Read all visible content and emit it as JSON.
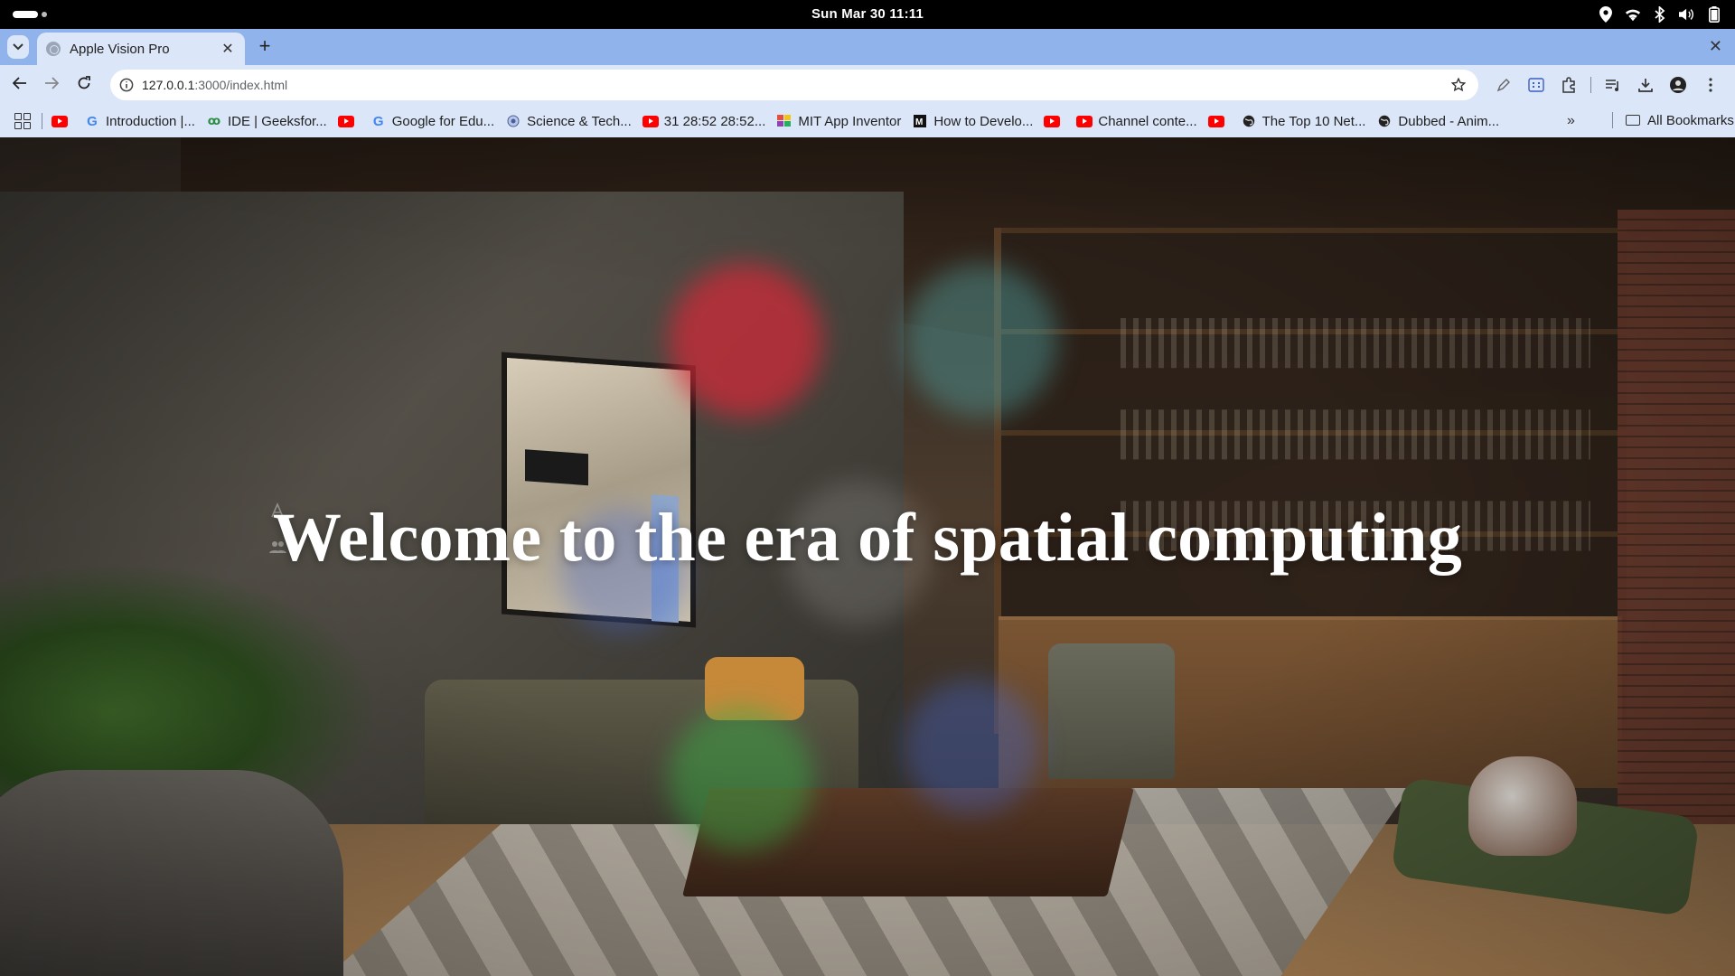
{
  "system_bar": {
    "clock": "Sun Mar 30  11:11",
    "tray_icons": [
      "location-icon",
      "wifi-icon",
      "bluetooth-icon",
      "volume-icon",
      "battery-icon"
    ]
  },
  "browser": {
    "tab": {
      "title": "Apple Vision Pro",
      "favicon": "globe-icon"
    },
    "address": {
      "host": "127.0.0.1",
      "path": ":3000/index.html"
    },
    "bookmarks": [
      {
        "label": "",
        "icon": "youtube-icon"
      },
      {
        "label": "Introduction  |...",
        "icon": "google-icon"
      },
      {
        "label": "IDE | Geeksfor...",
        "icon": "gfg-icon"
      },
      {
        "label": "",
        "icon": "youtube-icon"
      },
      {
        "label": "Google for Edu...",
        "icon": "google-icon"
      },
      {
        "label": "Science & Tech...",
        "icon": "emblem-icon"
      },
      {
        "label": "31 28:52 28:52...",
        "icon": "youtube-icon"
      },
      {
        "label": "MIT App Inventor",
        "icon": "mit-icon"
      },
      {
        "label": "How to Develo...",
        "icon": "medium-icon"
      },
      {
        "label": "",
        "icon": "youtube-icon"
      },
      {
        "label": "Channel conte...",
        "icon": "youtube-icon"
      },
      {
        "label": "",
        "icon": "youtube-icon"
      },
      {
        "label": "The Top 10 Net...",
        "icon": "globe-icon"
      },
      {
        "label": "Dubbed - Anim...",
        "icon": "globe-icon"
      }
    ],
    "all_bookmarks_label": "All Bookmarks"
  },
  "page": {
    "headline": "Welcome to the era of spatial computing"
  }
}
